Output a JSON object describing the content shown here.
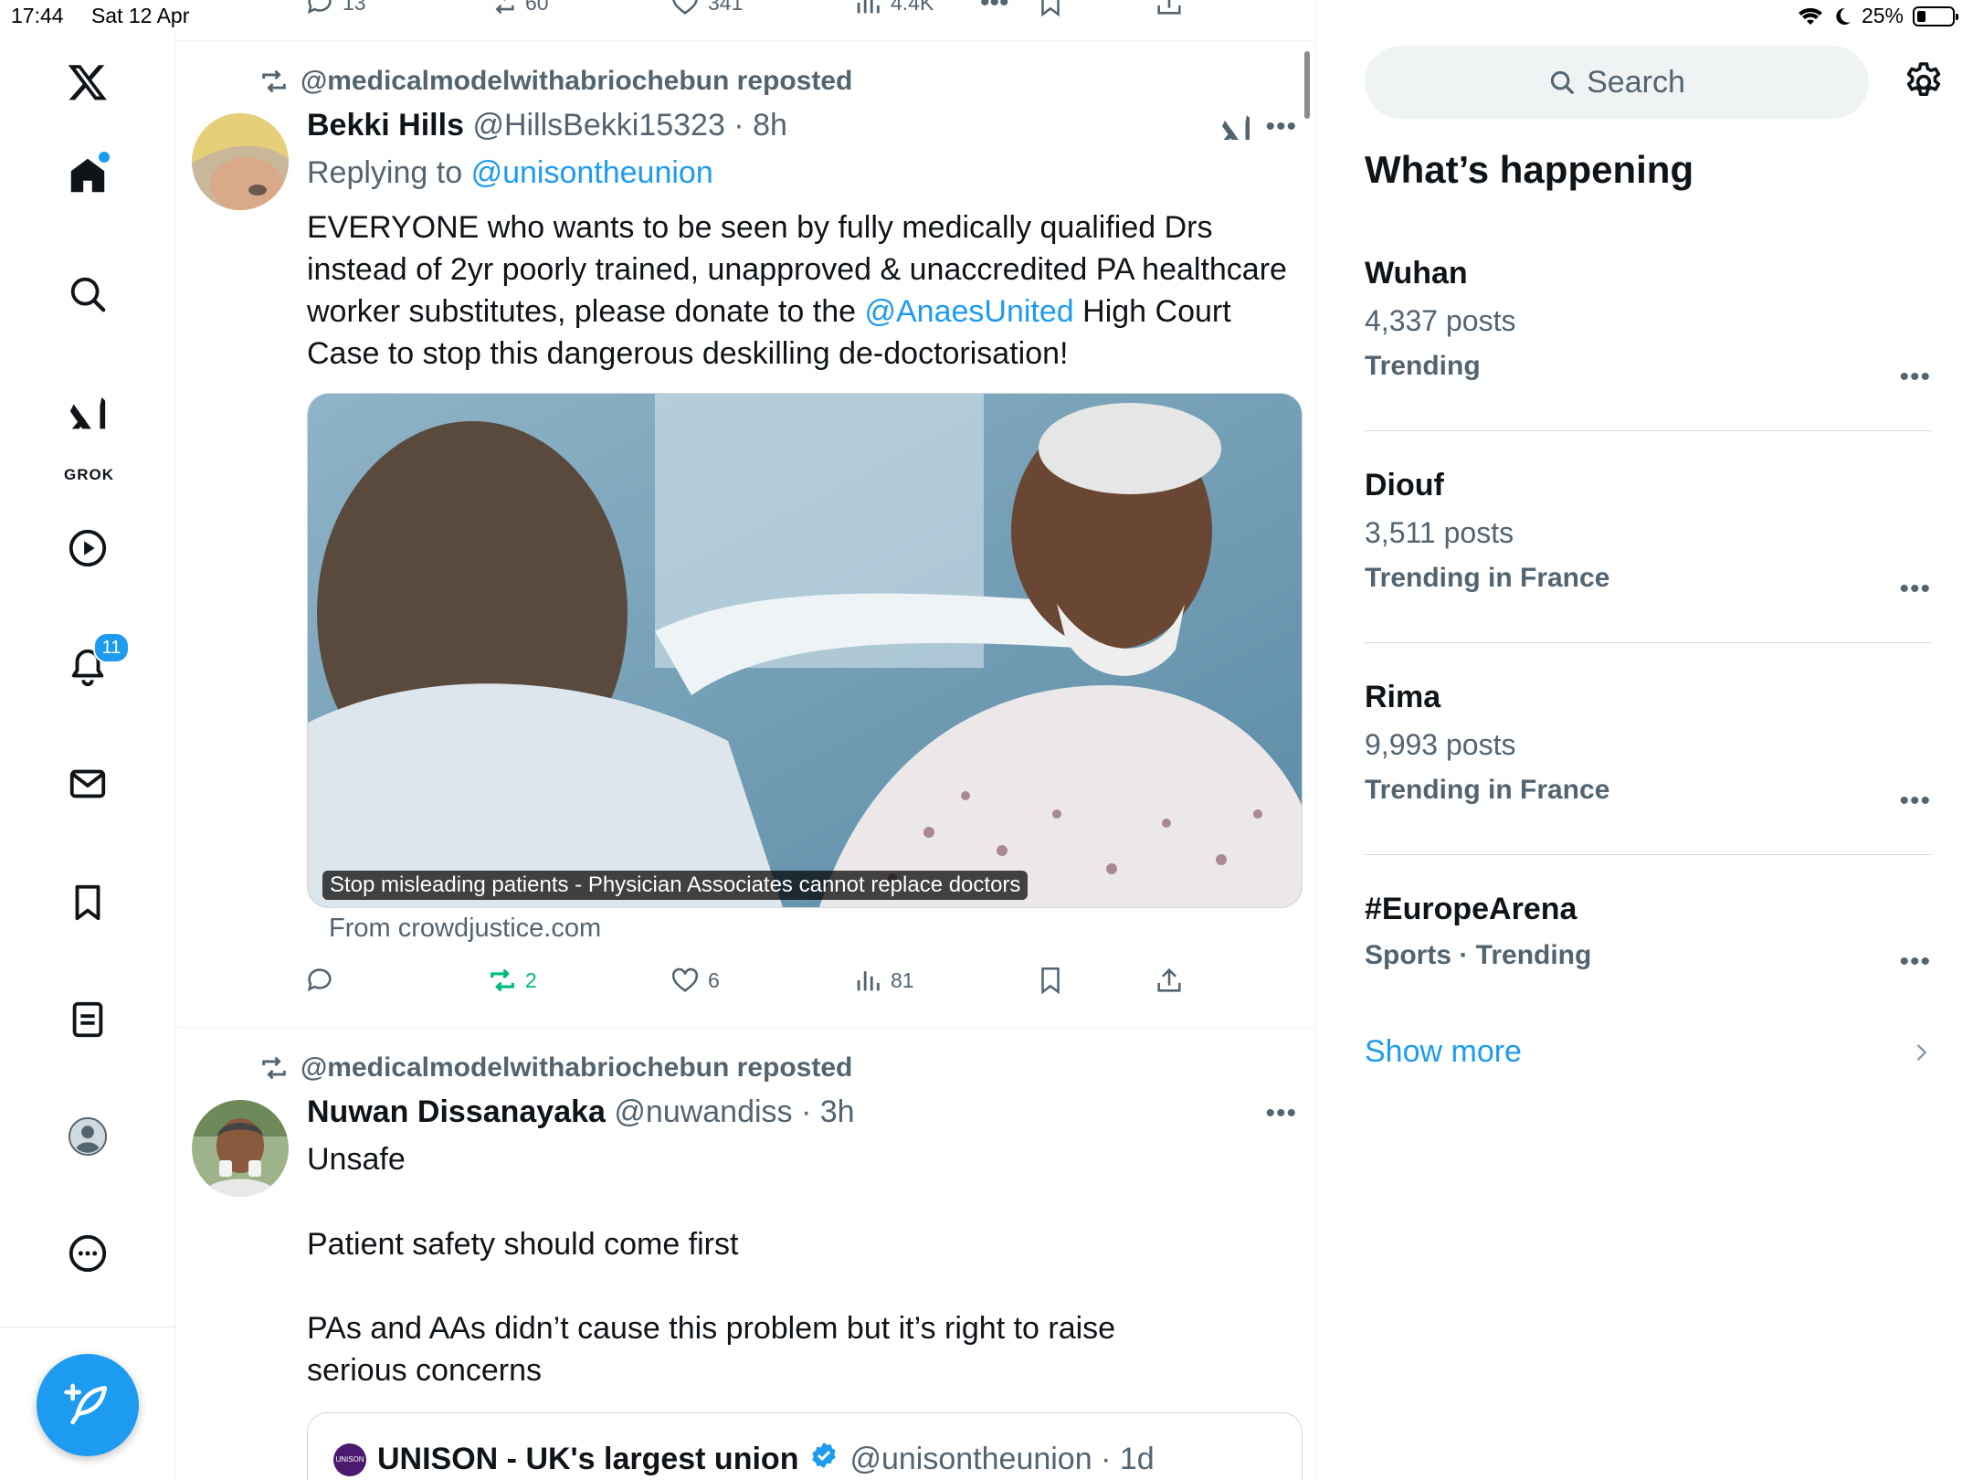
{
  "status_bar": {
    "time": "17:44",
    "date": "Sat 12 Apr",
    "battery": "25%"
  },
  "nav": {
    "grok_label": "GROK",
    "notifications_badge": "11"
  },
  "top_actions": {
    "replies": "13",
    "reposts": "60",
    "likes": "341",
    "views": "4.4K"
  },
  "post1": {
    "repost_by": "@medicalmodelwithabriochebun reposted",
    "author_name": "Bekki Hills",
    "author_handle": "@HillsBekki15323 · 8h",
    "replying_prefix": "Replying to",
    "replying_handle": "@unisontheunion",
    "text_a": "EVERYONE who wants to be seen by fully medically qualified Drs instead of 2yr poorly trained, unapproved & unaccredited PA healthcare worker substitutes, please donate to the",
    "text_mention": "@AnaesUnited",
    "text_b": "High Court Case to stop this dangerous deskilling de-doctorisation!",
    "card_caption": "Stop misleading patients - Physician Associates cannot replace doctors",
    "card_source": "From crowdjustice.com",
    "reposts": "2",
    "likes": "6",
    "views": "81"
  },
  "post2": {
    "repost_by": "@medicalmodelwithabriochebun reposted",
    "author_name": "Nuwan Dissanayaka",
    "author_handle": "@nuwandiss · 3h",
    "line1": "Unsafe",
    "line2": "Patient safety should come first",
    "line3": "PAs and AAs didn’t cause this problem but it’s right to raise serious concerns",
    "quote_name": "UNISON - UK's largest union",
    "quote_handle": "@unisontheunion · 1d",
    "quote_avatar_text": "UNISON"
  },
  "sidebar": {
    "search_placeholder": "Search",
    "section_title": "What’s happening",
    "trends": [
      {
        "name": "Wuhan",
        "count": "4,337 posts",
        "context": "Trending"
      },
      {
        "name": "Diouf",
        "count": "3,511 posts",
        "context": "Trending in France"
      },
      {
        "name": "Rima",
        "count": "9,993 posts",
        "context": "Trending in France"
      },
      {
        "name": "#EuropeArena",
        "count": "",
        "context": "Sports · Trending"
      }
    ],
    "show_more": "Show more"
  },
  "colors": {
    "accent": "#1d9bf0",
    "text_primary": "#0f1419",
    "text_secondary": "#536471",
    "repost_green": "#00ba7c"
  }
}
